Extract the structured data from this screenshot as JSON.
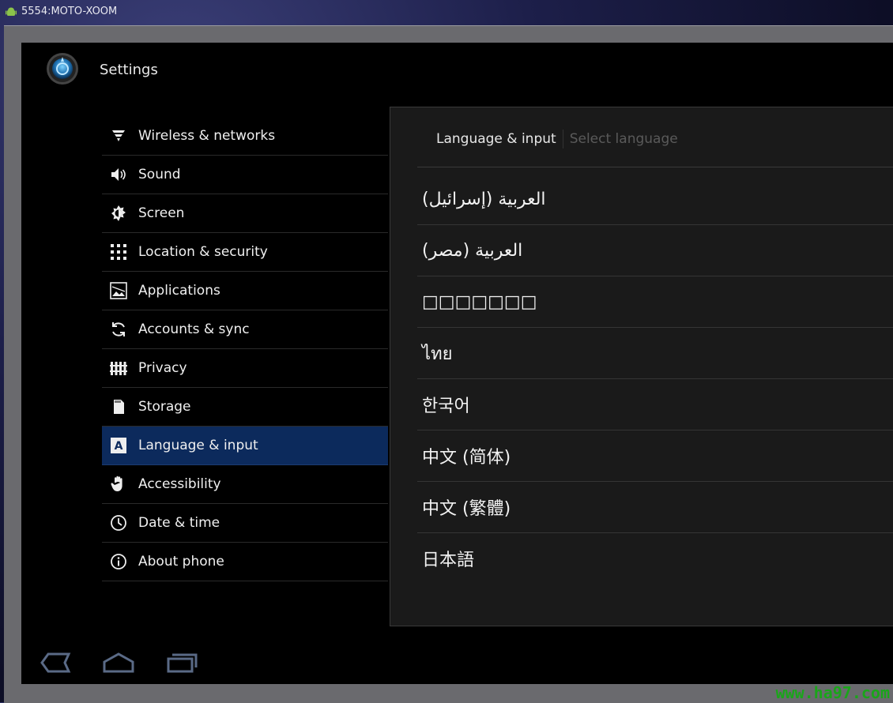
{
  "window": {
    "title": "5554:MOTO-XOOM"
  },
  "header": {
    "title": "Settings"
  },
  "menu": {
    "items": [
      {
        "label": "Wireless & networks",
        "icon": "wifi-icon"
      },
      {
        "label": "Sound",
        "icon": "speaker-icon"
      },
      {
        "label": "Screen",
        "icon": "brightness-icon"
      },
      {
        "label": "Location & security",
        "icon": "pattern-lock-icon"
      },
      {
        "label": "Applications",
        "icon": "applications-icon"
      },
      {
        "label": "Accounts & sync",
        "icon": "sync-icon"
      },
      {
        "label": "Privacy",
        "icon": "privacy-fence-icon"
      },
      {
        "label": "Storage",
        "icon": "sd-card-icon"
      },
      {
        "label": "Language & input",
        "icon": "language-icon",
        "selected": true
      },
      {
        "label": "Accessibility",
        "icon": "hand-icon"
      },
      {
        "label": "Date & time",
        "icon": "clock-icon"
      },
      {
        "label": "About phone",
        "icon": "info-icon"
      }
    ]
  },
  "panel": {
    "breadcrumb": {
      "parent": "Language & input",
      "current": "Select language"
    },
    "languages": [
      "العربية (إسرائيل)",
      "العربية (مصر)",
      "□□□□□□□",
      "ไทย",
      "한국어",
      "中文 (简体)",
      "中文 (繁體)",
      "日本語"
    ]
  },
  "watermark": "www.ha97.com",
  "colors": {
    "selected": "#0c2a5c",
    "panel": "#1a1a1a",
    "watermark": "#1aa51a"
  }
}
